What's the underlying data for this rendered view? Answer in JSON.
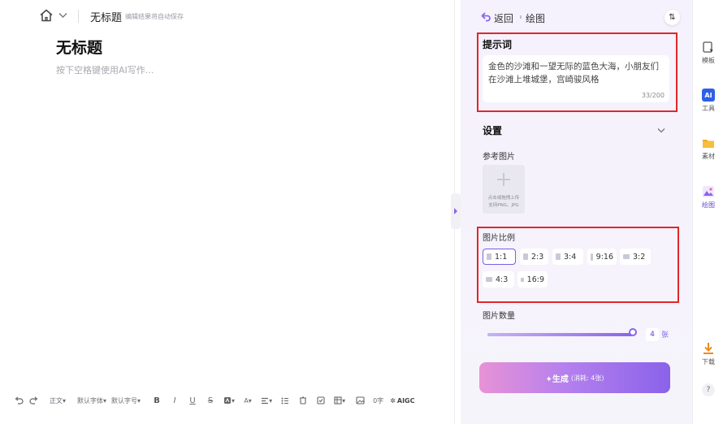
{
  "editor": {
    "doc_name": "无标题",
    "autosave_hint": "编辑结果将自动保存",
    "title": "无标题",
    "placeholder": "按下空格键使用AI写作..."
  },
  "toolbar": {
    "paragraph": "正文",
    "font_family": "默认字体",
    "font_size": "默认字号",
    "bold": "B",
    "italic": "I",
    "underline": "U",
    "strike": "S",
    "font_color": "A",
    "word_count": "0字",
    "aigc": "AIGC"
  },
  "panel": {
    "back_label": "返回",
    "mode_label": "绘图",
    "sort_icon": "⇅",
    "prompt": {
      "heading": "提示词",
      "text": "金色的沙滩和一望无际的蓝色大海，小朋友们在沙滩上堆城堡，宫崎骏风格",
      "counter": "33/200"
    },
    "settings": {
      "heading": "设置",
      "reference_label": "参考图片",
      "upload_line1": "点击或拖拽上传",
      "upload_line2": "支持PNG、JPG"
    },
    "ratio": {
      "heading": "图片比例",
      "options": [
        "1:1",
        "2:3",
        "3:4",
        "9:16",
        "3:2",
        "4:3",
        "16:9"
      ],
      "selected": "1:1"
    },
    "count": {
      "heading": "图片数量",
      "value": "4",
      "unit": "张",
      "fraction": 1.0
    },
    "generate": {
      "label": "✦生成",
      "cost": "(消耗: 4张)"
    }
  },
  "rail": {
    "items": [
      {
        "label": "模板",
        "icon": "template-icon"
      },
      {
        "label": "工具",
        "icon": "ai-tool-icon"
      },
      {
        "label": "素材",
        "icon": "folder-icon"
      },
      {
        "label": "绘图",
        "icon": "image-draw-icon"
      },
      {
        "label": "下载",
        "icon": "download-icon"
      }
    ],
    "ai_badge": "AI",
    "help": "?"
  },
  "colors": {
    "accent": "#7b5ce0",
    "highlight_box": "#e2262a",
    "panel_bg": "#f5f1fd"
  }
}
